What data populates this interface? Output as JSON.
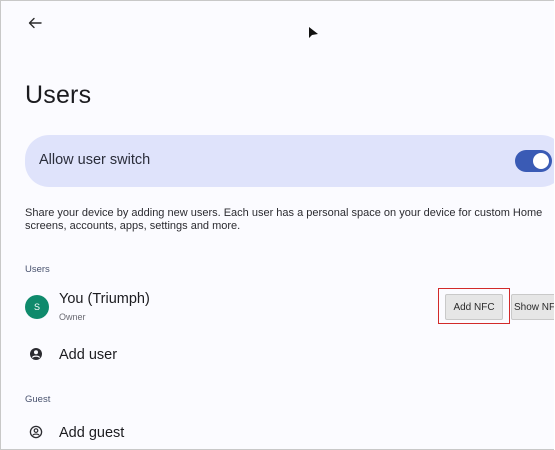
{
  "page": {
    "title": "Users"
  },
  "allow_switch": {
    "label": "Allow user switch",
    "enabled": true,
    "accent_color": "#3a5bb5"
  },
  "description": "Share your device by adding new users. Each user has a personal space on your device for custom Home screens, accounts, apps, settings and more.",
  "sections": {
    "users_header": "Users",
    "guest_header": "Guest"
  },
  "current_user": {
    "avatar_initial": "S",
    "name": "You (Triumph)",
    "role": "Owner",
    "avatar_color": "#0f8a6c"
  },
  "nfc_buttons": {
    "add_label": "Add NFC",
    "show_label": "Show NFC"
  },
  "actions": {
    "add_user": "Add user",
    "add_guest": "Add guest"
  },
  "icons": {
    "back": "back-arrow-icon",
    "cursor": "mouse-pointer-icon",
    "add_user": "person-add-icon",
    "add_guest": "guest-icon"
  }
}
